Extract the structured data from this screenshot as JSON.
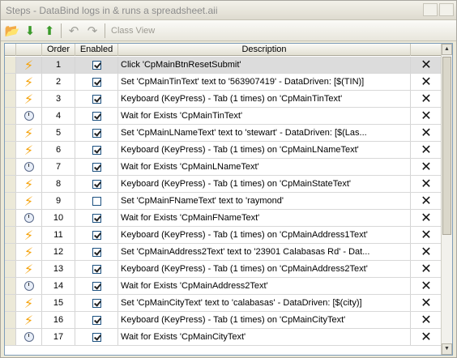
{
  "window": {
    "title": "Steps - DataBind logs in & runs a spreadsheet.aii"
  },
  "toolbar": {
    "buttons": [
      {
        "name": "open-folder-icon",
        "glyph": "📂"
      },
      {
        "name": "move-down-icon",
        "glyph": "⬇"
      },
      {
        "name": "move-up-icon",
        "glyph": "⬆"
      },
      {
        "name": "undo-icon",
        "glyph": "↶"
      },
      {
        "name": "redo-icon",
        "glyph": "↷"
      }
    ],
    "class_view_label": "Class View"
  },
  "grid": {
    "columns": [
      "",
      "",
      "Order",
      "Enabled",
      "Description",
      ""
    ],
    "rows": [
      {
        "icon": "bolt",
        "order": "1",
        "enabled": true,
        "description": "Click 'CpMainBtnResetSubmit'",
        "selected": true
      },
      {
        "icon": "bolt",
        "order": "2",
        "enabled": true,
        "description": "Set 'CpMainTinText' text to '563907419' - DataDriven: [$(TIN)]"
      },
      {
        "icon": "bolt",
        "order": "3",
        "enabled": true,
        "description": "Keyboard (KeyPress) - Tab (1 times) on 'CpMainTinText'"
      },
      {
        "icon": "watch",
        "order": "4",
        "enabled": true,
        "description": "Wait for Exists 'CpMainTinText'"
      },
      {
        "icon": "bolt",
        "order": "5",
        "enabled": true,
        "description": "Set 'CpMainLNameText' text to 'stewart' - DataDriven: [$(Las..."
      },
      {
        "icon": "bolt",
        "order": "6",
        "enabled": true,
        "description": "Keyboard (KeyPress) - Tab (1 times) on 'CpMainLNameText'"
      },
      {
        "icon": "watch",
        "order": "7",
        "enabled": true,
        "description": "Wait for Exists 'CpMainLNameText'"
      },
      {
        "icon": "bolt",
        "order": "8",
        "enabled": true,
        "description": "Keyboard (KeyPress) - Tab (1 times) on 'CpMainStateText'"
      },
      {
        "icon": "bolt",
        "order": "9",
        "enabled": false,
        "description": "Set 'CpMainFNameText' text to 'raymond'"
      },
      {
        "icon": "watch",
        "order": "10",
        "enabled": true,
        "description": "Wait for Exists 'CpMainFNameText'"
      },
      {
        "icon": "bolt",
        "order": "11",
        "enabled": true,
        "description": "Keyboard (KeyPress) - Tab (1 times) on 'CpMainAddress1Text'"
      },
      {
        "icon": "bolt",
        "order": "12",
        "enabled": true,
        "description": "Set 'CpMainAddress2Text' text to '23901 Calabasas Rd' - Dat..."
      },
      {
        "icon": "bolt",
        "order": "13",
        "enabled": true,
        "description": "Keyboard (KeyPress) - Tab (1 times) on 'CpMainAddress2Text'"
      },
      {
        "icon": "watch",
        "order": "14",
        "enabled": true,
        "description": "Wait for Exists 'CpMainAddress2Text'"
      },
      {
        "icon": "bolt",
        "order": "15",
        "enabled": true,
        "description": "Set 'CpMainCityText' text to 'calabasas' - DataDriven: [$(city)]"
      },
      {
        "icon": "bolt",
        "order": "16",
        "enabled": true,
        "description": "Keyboard (KeyPress) - Tab (1 times) on 'CpMainCityText'"
      },
      {
        "icon": "watch",
        "order": "17",
        "enabled": true,
        "description": "Wait for Exists 'CpMainCityText'"
      }
    ],
    "delete_glyph": "✕"
  },
  "colors": {
    "bolt": "#f5a20a",
    "selected_row": "#dcdcdc",
    "grid_border": "#7f9db9"
  }
}
